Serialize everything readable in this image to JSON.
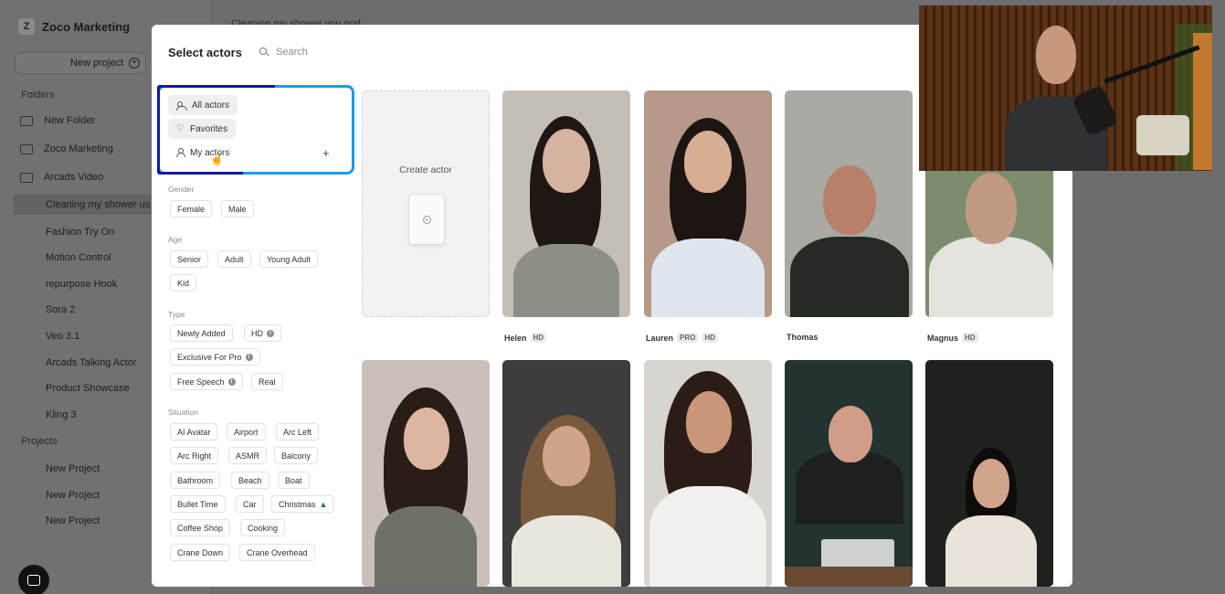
{
  "sidebar": {
    "workspace_initial": "Z",
    "workspace_name": "Zoco Marketing",
    "new_project_label": "New project",
    "folders_heading": "Folders",
    "folders": [
      "New Folder",
      "Zoco Marketing",
      "Arcads Video"
    ],
    "items": [
      "Cleaning my shower us",
      "Fashion Try On",
      "Motion Control",
      "repurpose Hook",
      "Sora 2",
      "Veo 3.1",
      "Arcads Talking Actor",
      "Product Showcase",
      "Kling 3"
    ],
    "projects_heading": "Projects",
    "projects": [
      "New Project",
      "New Project",
      "New Project"
    ]
  },
  "breadcrumb": "Cleaning my shower you nod",
  "modal": {
    "title": "Select actors",
    "search_placeholder": "Search",
    "nav": {
      "all": "All actors",
      "favorites": "Favorites",
      "mine": "My actors",
      "add": "+"
    },
    "groups": {
      "gender": {
        "label": "Gender",
        "chips": [
          "Female",
          "Male"
        ]
      },
      "age": {
        "label": "Age",
        "chips": [
          "Senior",
          "Adult",
          "Young Adult",
          "Kid"
        ]
      },
      "type": {
        "label": "Type",
        "chips": [
          "Newly Added",
          "HD",
          "Exclusive For Pro",
          "Free Speech",
          "Real"
        ]
      },
      "situation": {
        "label": "Situation",
        "chips": [
          "AI Avatar",
          "Airport",
          "Arc Left",
          "Arc Right",
          "ASMR",
          "Balcony",
          "Bathroom",
          "Beach",
          "Boat",
          "Bullet Time",
          "Car",
          "Christmas",
          "Coffee Shop",
          "Cooking",
          "Crane Down",
          "Crane Overhead"
        ]
      }
    },
    "create_label": "Create actor",
    "actors": [
      {
        "name": "Helen",
        "badges": [
          "HD"
        ]
      },
      {
        "name": "Lauren",
        "badges": [
          "PRO",
          "HD"
        ]
      },
      {
        "name": "Thomas",
        "badges": []
      },
      {
        "name": "Magnus",
        "badges": [
          "HD"
        ]
      }
    ]
  },
  "colors": {
    "highlight_blue": "#1e9be8",
    "highlight_navy": "#1219a3"
  }
}
